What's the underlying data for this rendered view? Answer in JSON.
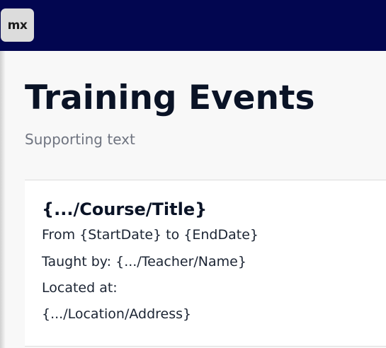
{
  "header": {
    "logo_text": "mx"
  },
  "page": {
    "title": "Training Events",
    "supporting_text": "Supporting text"
  },
  "event_card": {
    "title": "{.../Course/Title}",
    "dates_line": "From {StartDate} to {EndDate}",
    "teacher_line": "Taught by: {.../Teacher/Name}",
    "location_label": "Located at:",
    "location_address": "{.../Location/Address}"
  }
}
